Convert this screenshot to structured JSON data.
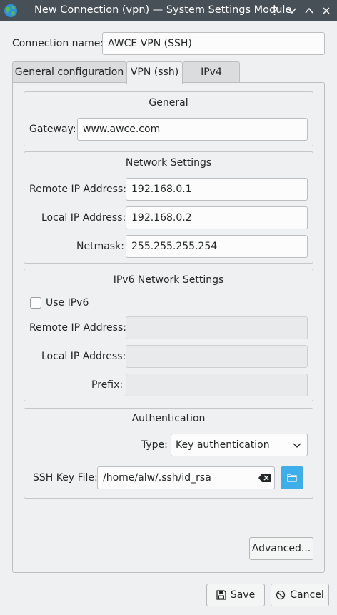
{
  "window": {
    "title": "New Connection (vpn) — System Settings Module",
    "help_glyph": "?",
    "minimize_glyph": "∨",
    "maximize_glyph": "∧",
    "close_glyph": "✕"
  },
  "connection": {
    "name_label": "Connection name:",
    "name_value": "AWCE VPN (SSH)"
  },
  "tabs": [
    {
      "label": "General configuration",
      "active": false
    },
    {
      "label": "VPN (ssh)",
      "active": true
    },
    {
      "label": "IPv4",
      "active": false
    }
  ],
  "general": {
    "title": "General",
    "gateway_label": "Gateway:",
    "gateway_value": "www.awce.com"
  },
  "network": {
    "title": "Network Settings",
    "remote_ip_label": "Remote IP Address:",
    "remote_ip_value": "192.168.0.1",
    "local_ip_label": "Local IP Address:",
    "local_ip_value": "192.168.0.2",
    "netmask_label": "Netmask:",
    "netmask_value": "255.255.255.254"
  },
  "ipv6": {
    "title": "IPv6 Network Settings",
    "use_ipv6_label": "Use IPv6",
    "use_ipv6_checked": false,
    "remote_ip_label": "Remote IP Address:",
    "remote_ip_value": "",
    "local_ip_label": "Local IP Address:",
    "local_ip_value": "",
    "prefix_label": "Prefix:",
    "prefix_value": ""
  },
  "auth": {
    "title": "Authentication",
    "type_label": "Type:",
    "type_value": "Key authentication",
    "ssh_key_label": "SSH Key File:",
    "ssh_key_value": "/home/alw/.ssh/id_rsa"
  },
  "buttons": {
    "advanced": "Advanced...",
    "save": "Save",
    "cancel": "Cancel"
  },
  "colors": {
    "titlebar": "#475057",
    "window_bg": "#eff0f1",
    "accent": "#3daee9"
  }
}
